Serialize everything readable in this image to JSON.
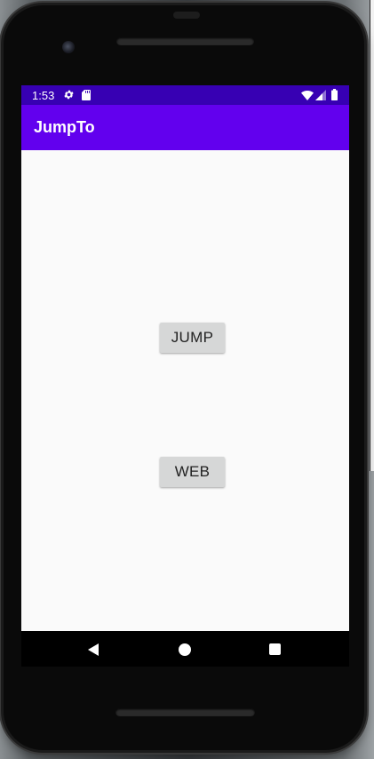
{
  "status_bar": {
    "time": "1:53",
    "icons": [
      "gear-icon",
      "sd-card-icon",
      "wifi-icon",
      "signal-icon",
      "battery-icon"
    ]
  },
  "app_bar": {
    "title": "JumpTo",
    "color": "#6200ee",
    "status_color": "#3700b3"
  },
  "main": {
    "jump_label": "JUMP",
    "web_label": "WEB"
  },
  "nav_bar": {
    "icons": [
      "back-icon",
      "home-icon",
      "recents-icon"
    ]
  }
}
